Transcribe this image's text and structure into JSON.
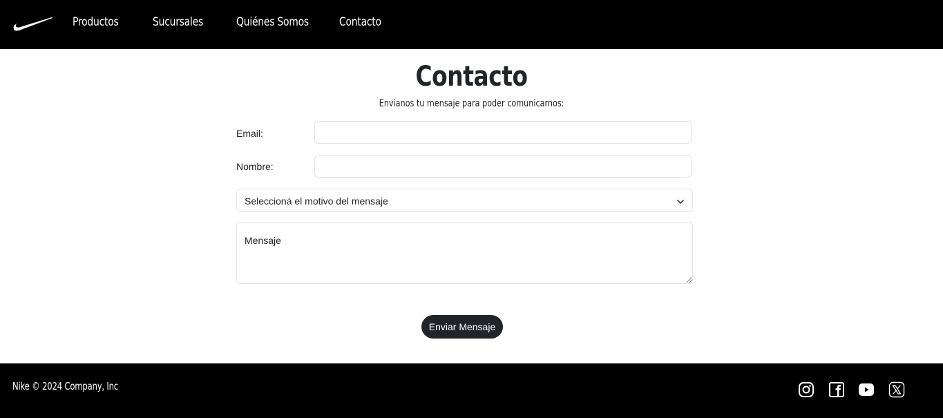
{
  "navbar": {
    "logo_icon": "nike-swoosh-icon",
    "links": [
      "Productos",
      "Sucursales",
      "Quiénes Somos",
      "Contacto"
    ]
  },
  "main": {
    "title": "Contacto",
    "subtitle": "Envianos tu mensaje para poder comunicarnos:",
    "form": {
      "email_label": "Email:",
      "email_value": "",
      "name_label": "Nombre:",
      "name_value": "",
      "reason_select_value": "Seleccioná el motivo del mensaje",
      "message_placeholder": "Mensaje",
      "submit_label": "Enviar Mensaje"
    }
  },
  "footer": {
    "copyright": "Nike © 2024 Company, Inc",
    "social_icons": [
      "instagram-icon",
      "facebook-icon",
      "youtube-icon",
      "x-twitter-icon"
    ]
  },
  "colors": {
    "bar_background": "#000000",
    "button_background": "#212529",
    "input_border": "#dee2e6",
    "text": "#212529"
  }
}
